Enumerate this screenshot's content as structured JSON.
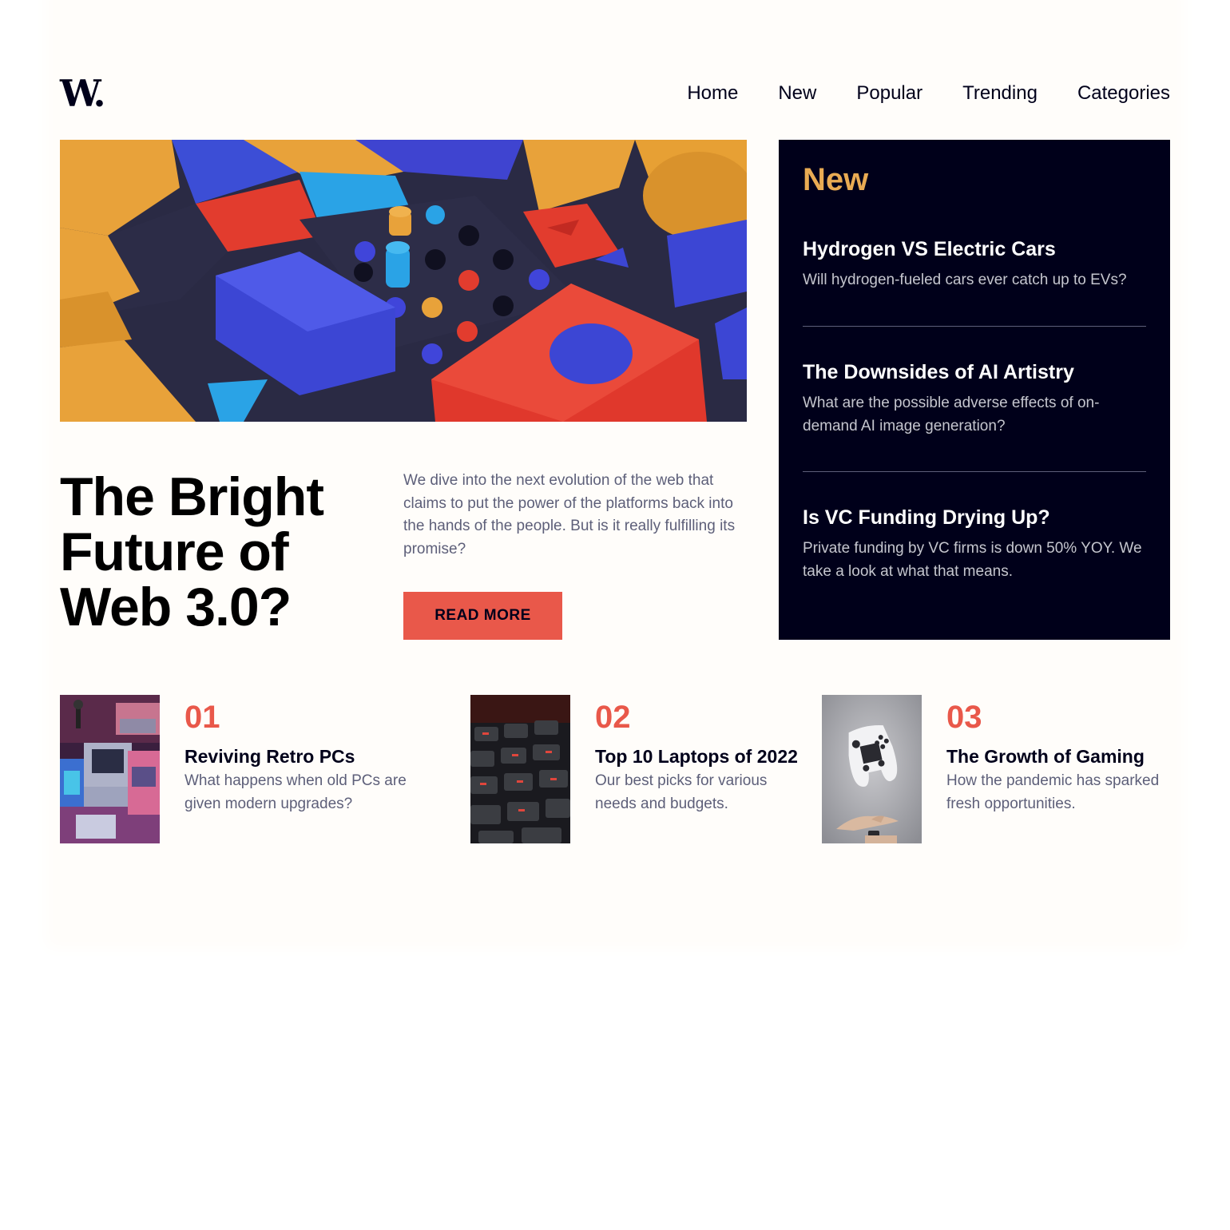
{
  "header": {
    "logo": "W.",
    "nav": [
      "Home",
      "New",
      "Popular",
      "Trending",
      "Categories"
    ]
  },
  "hero": {
    "title": "The Bright Future of Web 3.0?",
    "description": "We dive into the next evolution of the web that claims to put the power of the platforms back into the hands of the people. But is it really fulfilling its promise?",
    "button": "READ MORE"
  },
  "new_panel": {
    "heading": "New",
    "items": [
      {
        "title": "Hydrogen VS Electric Cars",
        "description": "Will hydrogen-fueled cars ever catch up to EVs?"
      },
      {
        "title": "The Downsides of AI Artistry",
        "description": "What are the possible adverse effects of on-demand AI image generation?"
      },
      {
        "title": "Is VC Funding Drying Up?",
        "description": "Private funding by VC firms is down 50% YOY. We take a look at what that means."
      }
    ]
  },
  "cards": [
    {
      "number": "01",
      "title": "Reviving Retro PCs",
      "description": "What happens when old PCs are given modern upgrades?"
    },
    {
      "number": "02",
      "title": "Top 10 Laptops of 2022",
      "description": "Our best picks for various needs and budgets."
    },
    {
      "number": "03",
      "title": "The Growth of Gaming",
      "description": "How the pandemic has sparked fresh opportunities."
    }
  ],
  "colors": {
    "page_background": "#fffdfa",
    "dark_navy": "#00001a",
    "soft_red": "#e9584a",
    "soft_orange": "#e9ab53",
    "grayish_blue": "#5d5f79",
    "grayish_light": "#c5c6ce"
  },
  "icons": {
    "logo": "w-logo"
  }
}
